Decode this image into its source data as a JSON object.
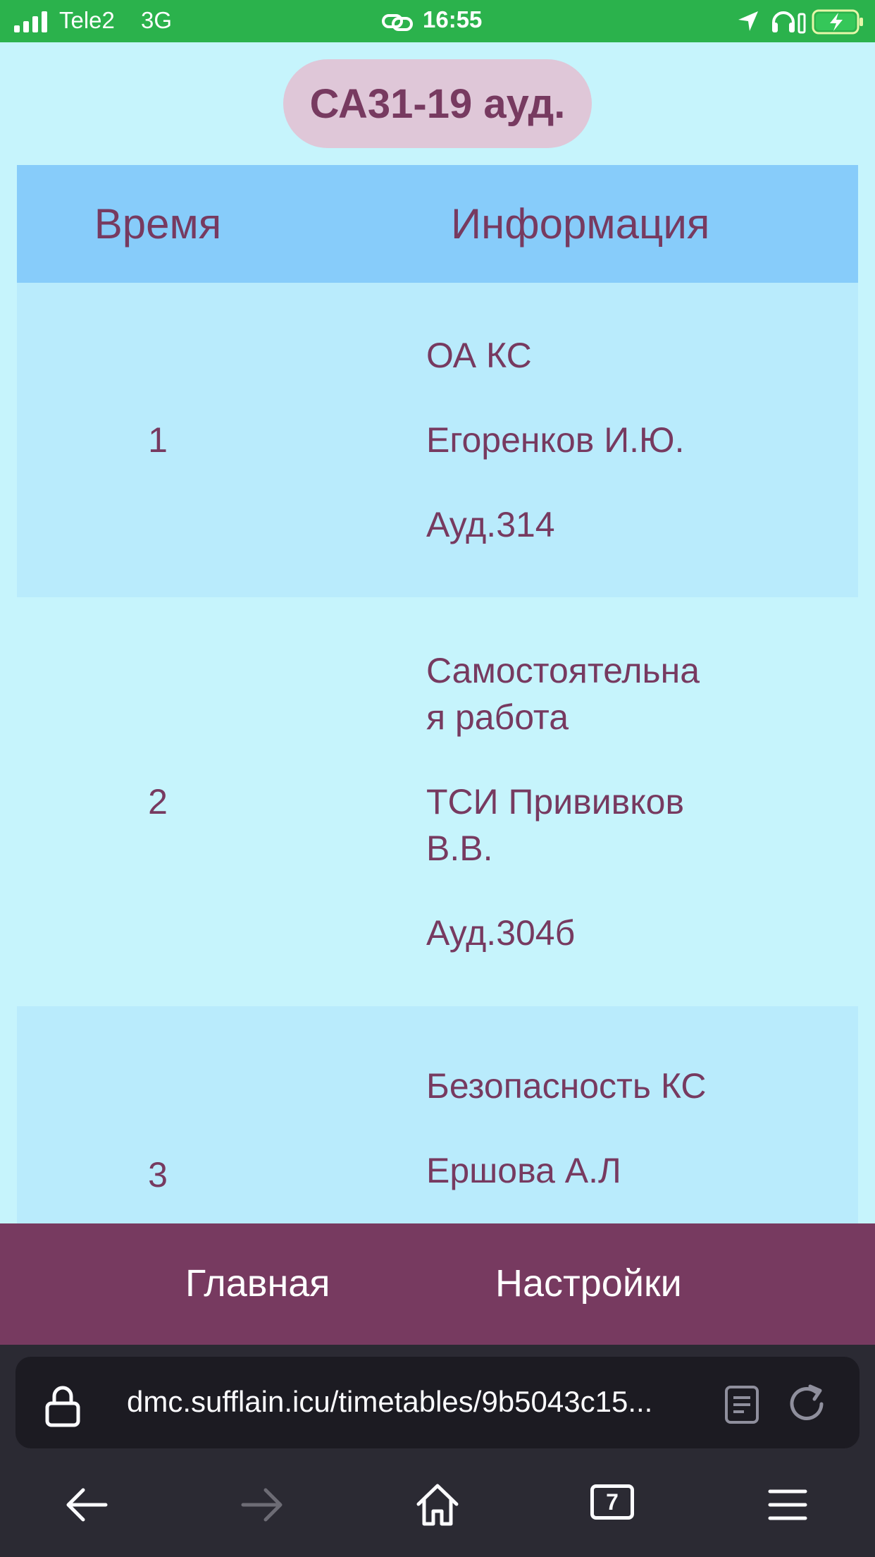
{
  "status_bar": {
    "carrier": "Tele2",
    "network": "3G",
    "time": "16:55"
  },
  "header": {
    "group_title": "СА31-19 ауд."
  },
  "table": {
    "columns": [
      "Время",
      "Информация"
    ],
    "rows": [
      {
        "num": "1",
        "subject": "ОА КС",
        "teacher": "Егоренков И.Ю.",
        "room": "Ауд.314"
      },
      {
        "num": "2",
        "subject_line1": "Самостоятельна",
        "subject_line2": "я работа",
        "teacher_line1": "ТСИ Прививков",
        "teacher_line2": "В.В.",
        "room": "Ауд.304б"
      },
      {
        "num": "3",
        "subject": "Безопасность КС",
        "teacher": "Ершова А.Л"
      }
    ]
  },
  "app_nav": {
    "home_label": "Главная",
    "settings_label": "Настройки"
  },
  "browser": {
    "url": "dmc.sufflain.icu/timetables/9b5043c15...",
    "tab_count": "7"
  },
  "colors": {
    "status_bar": "#2bb24c",
    "page_bg": "#c6f4fc",
    "table_header": "#87ccfa",
    "row_shade": "#b9ebfc",
    "accent_text": "#773a60",
    "pill_bg": "#dfc7d8",
    "browser_bg": "#2b2a33"
  }
}
